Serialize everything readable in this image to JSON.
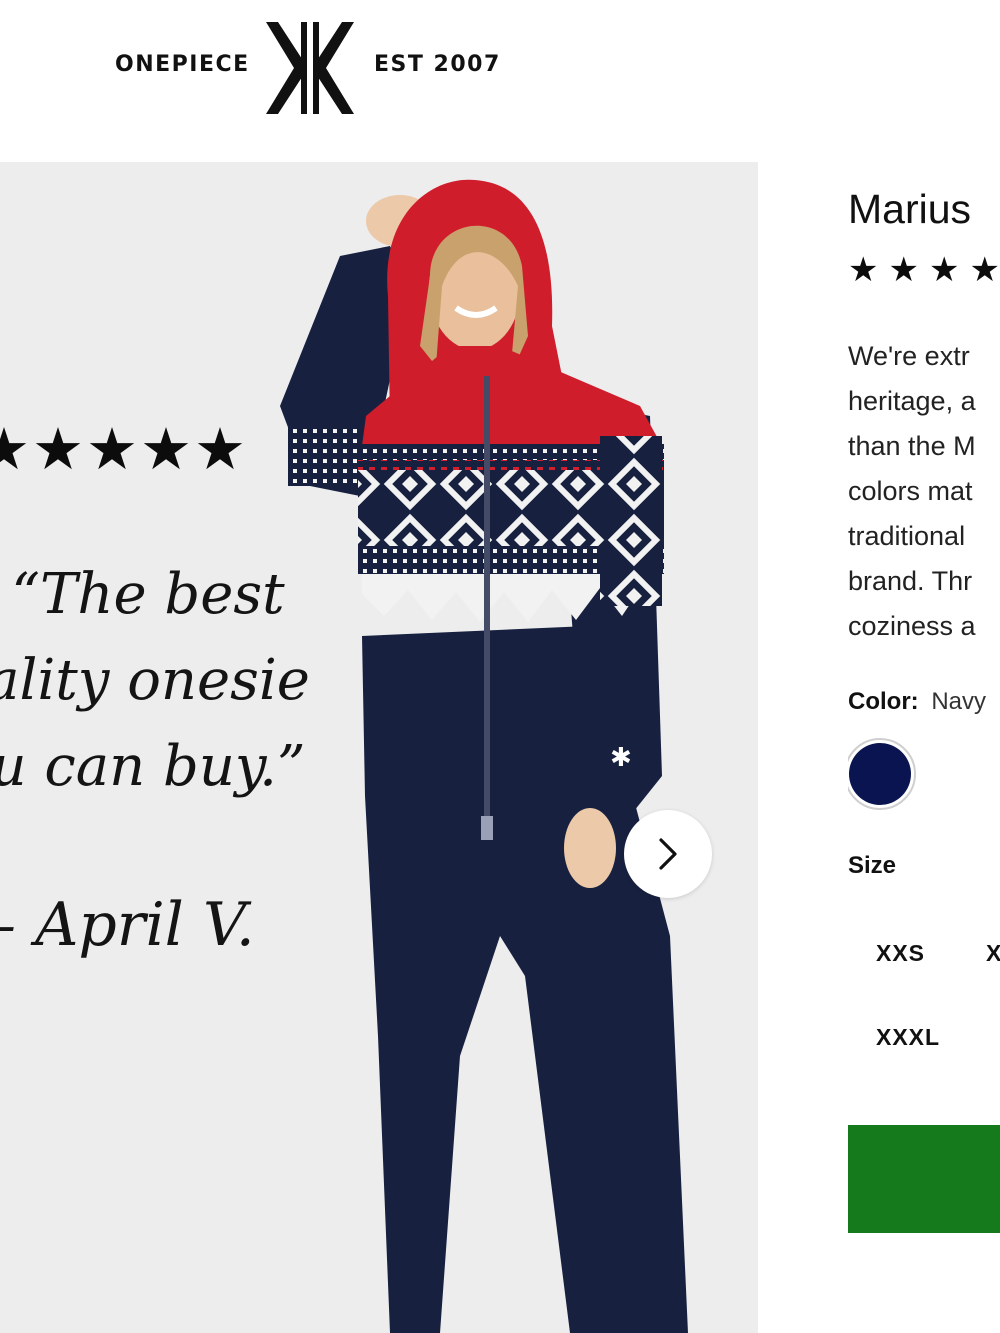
{
  "header": {
    "brand_left": "ONEPIECE",
    "brand_right": "EST  2007",
    "logo_icon": "onepiece-k-logo-icon"
  },
  "gallery": {
    "review_stars": "★★★★★",
    "quote_lines": [
      "“The best",
      "ality onesie",
      "u can buy.”"
    ],
    "author": "– April V.",
    "next_icon": "chevron-right-icon",
    "background": "#ededed"
  },
  "product": {
    "title": "Marius",
    "rating_stars": "★★★★",
    "description_lines": [
      "We're extr",
      "heritage, a",
      "than the M",
      "colors mat",
      "traditional",
      "brand. Thr",
      "coziness a"
    ],
    "color_label": "Color:",
    "color_value": "Navy",
    "swatch_color": "#0a1450",
    "size_label": "Size",
    "sizes": [
      "XXS",
      "X",
      "XXXL"
    ],
    "add_button_color": "#157a1c"
  }
}
